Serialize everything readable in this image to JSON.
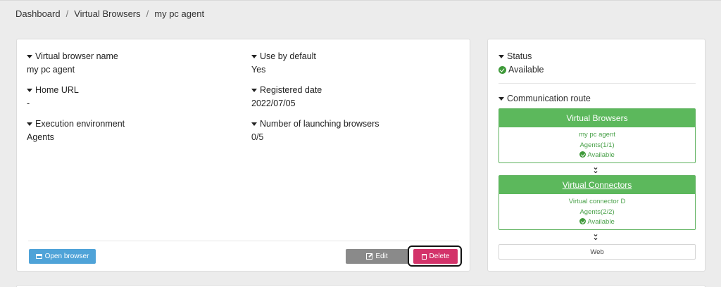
{
  "breadcrumb": {
    "items": [
      "Dashboard",
      "Virtual Browsers",
      "my pc agent"
    ],
    "separator": "/"
  },
  "details": {
    "name_label": "Virtual browser name",
    "name_value": "my pc agent",
    "default_label": "Use by default",
    "default_value": "Yes",
    "home_label": "Home URL",
    "home_value": "-",
    "date_label": "Registered date",
    "date_value": "2022/07/05",
    "env_label": "Execution environment",
    "env_value": "Agents",
    "launch_label": "Number of launching browsers",
    "launch_value": "0/5"
  },
  "actions": {
    "open_label": "Open browser",
    "edit_label": "Edit",
    "delete_label": "Delete"
  },
  "status": {
    "label": "Status",
    "value": "Available"
  },
  "route": {
    "label": "Communication route",
    "box1": {
      "title": "Virtual Browsers",
      "line1": "my pc agent",
      "line2": "Agents(1/1)",
      "line3": "Available"
    },
    "box2": {
      "title": "Virtual Connectors",
      "line1": "Virtual connector D",
      "line2": "Agents(2/2)",
      "line3": "Available"
    },
    "web": "Web"
  },
  "colors": {
    "accent_green": "#5cb85c",
    "open_blue": "#4fa3d8",
    "edit_gray": "#8a8a8a",
    "delete_pink": "#d3336a"
  }
}
